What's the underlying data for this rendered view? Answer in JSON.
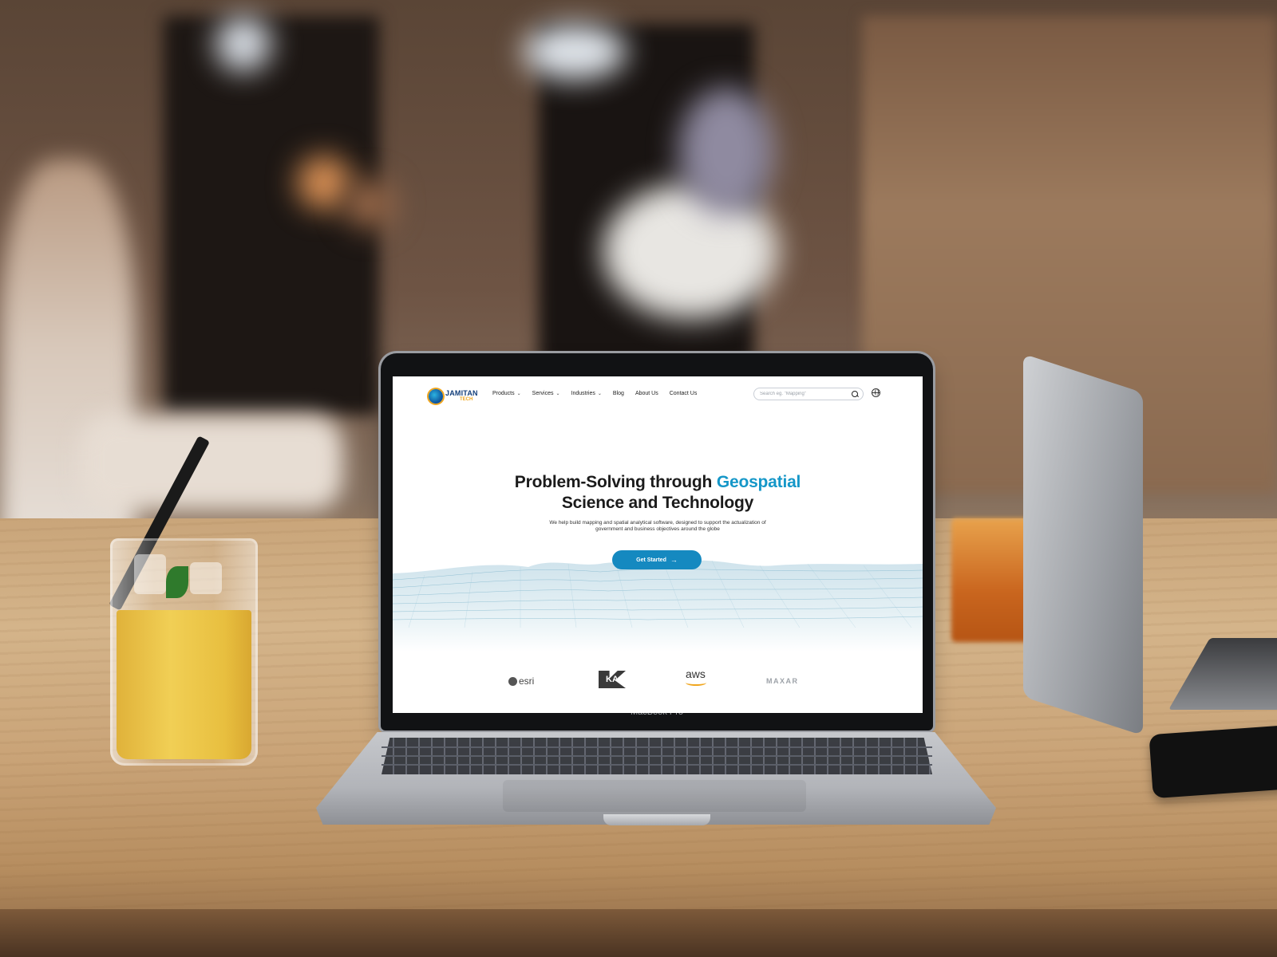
{
  "site": {
    "logo": {
      "name": "JAMITAN",
      "sub": "TECH"
    },
    "nav": {
      "items": [
        {
          "label": "Products",
          "has_dropdown": true
        },
        {
          "label": "Services",
          "has_dropdown": true
        },
        {
          "label": "Industries",
          "has_dropdown": true
        },
        {
          "label": "Blog",
          "has_dropdown": false
        },
        {
          "label": "About Us",
          "has_dropdown": false
        },
        {
          "label": "Contact Us",
          "has_dropdown": false
        }
      ],
      "search_placeholder": "Search eg. \"Mapping\"",
      "search_icon": "search-icon",
      "language_icon": "globe-icon"
    },
    "hero": {
      "title_part1": "Problem-Solving through ",
      "title_accent": "Geospatial",
      "title_part2": "Science and Technology",
      "subtitle": "We help build mapping and spatial analytical software, designed to support the actualization of government and business objectives around the globe",
      "cta_label": "Get Started",
      "cta_icon": "arrow-right-icon"
    },
    "partners": [
      "esri",
      "KA",
      "aws",
      "MAXAR"
    ],
    "colors": {
      "accent": "#1597c8",
      "button": "#1589c0",
      "logo_blue": "#123e7a",
      "logo_orange": "#f0a61e"
    }
  },
  "device": {
    "label": "MacBook Pro"
  }
}
